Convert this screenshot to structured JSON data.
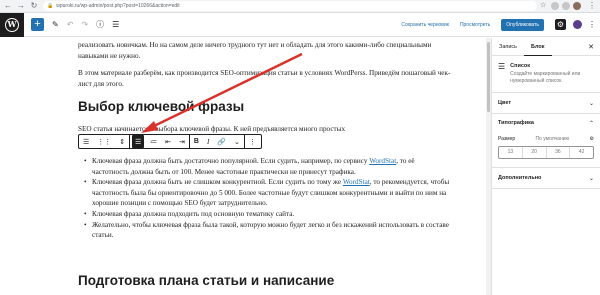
{
  "browser": {
    "url": "wpuroki.ru/wp-admin/post.php?post=10266&action=edit"
  },
  "editor_toolbar": {
    "save_draft": "Сохранить черновик",
    "preview": "Просмотреть",
    "publish": "Опубликовать"
  },
  "content": {
    "para1": "реализовать новичкам. Но на самом деле ничего трудного тут нет и обладать для этого какими-либо специальными навыками не нужно.",
    "para2": "В этом материале разберём, как производится SEO-оптимизация статьи в условиях WordPerss. Приведём пошаговый чек-лист для этого.",
    "heading1": "Выбор ключевой фразы",
    "para3": "SEO статья начинается с выбора ключевой фразы. К ней предъявляется много простых",
    "bullets": [
      {
        "before": "Ключевая фраза должна быть достаточно популярной. Если судить, например, по сервису ",
        "link": "WordStat",
        "after": ", то  её частотность должна быть от 100. Менее частотные практически не принесут трафика."
      },
      {
        "before": "Ключевая фраза должна быть не слишком конкурентной. Если судить по тому же ",
        "link": "WordStat",
        "after": ", то рекомендуется, чтобы частотность была бы ориентировочно до 5 000. Более частотные будут слишком конкурентными и выйти по ним на хорошие позиции с помощью SEO будет затруднительно."
      },
      {
        "before": "Ключевая фраза должна подходить под основную тематику сайта.",
        "link": "",
        "after": ""
      },
      {
        "before": "Желательно, чтобы ключевая фраза была такой, которую можно будет легко и без искажений использовать в составе статьи.",
        "link": "",
        "after": ""
      }
    ],
    "heading2": "Подготовка плана статьи и написание"
  },
  "sidebar": {
    "tab_post": "Запись",
    "tab_block": "Блок",
    "block_title": "Список",
    "block_desc": "Создайте маркированный или нумерованный список.",
    "color": "Цвет",
    "typography": "Типографика",
    "size_label": "Размер",
    "size_default": "По умолчанию",
    "sizes": [
      "13",
      "20",
      "36",
      "42"
    ],
    "advanced": "Дополнительно"
  },
  "colors": {
    "accent": "#2271b1",
    "arrow": "#d9322b"
  }
}
